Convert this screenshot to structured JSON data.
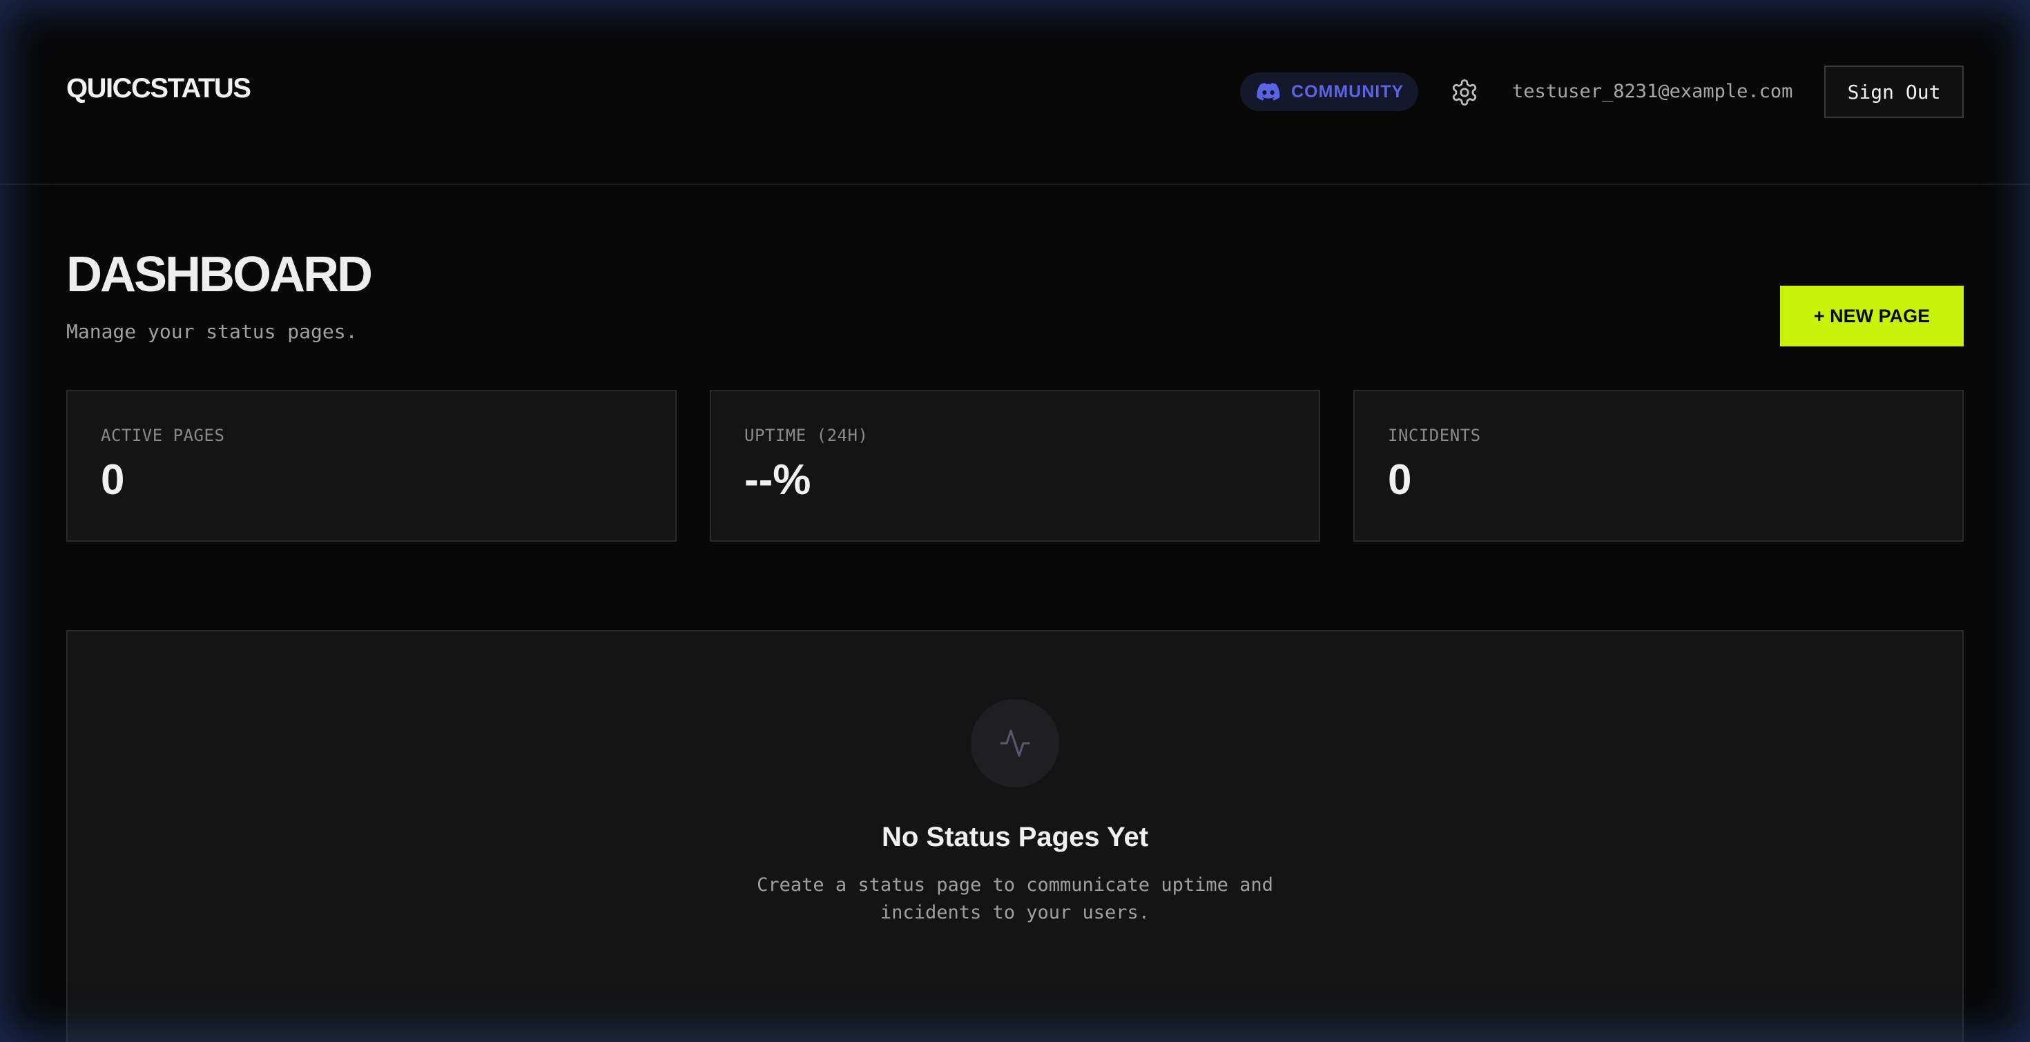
{
  "header": {
    "brand": "QUICCSTATUS",
    "community_label": "COMMUNITY",
    "user_email": "testuser_8231@example.com",
    "sign_out_label": "Sign Out"
  },
  "dashboard": {
    "title": "DASHBOARD",
    "subtitle": "Manage your status pages.",
    "new_page_label": "+ NEW PAGE"
  },
  "stats": [
    {
      "label": "ACTIVE PAGES",
      "value": "0"
    },
    {
      "label": "UPTIME (24H)",
      "value": "--%"
    },
    {
      "label": "INCIDENTS",
      "value": "0"
    }
  ],
  "empty_state": {
    "title": "No Status Pages Yet",
    "text": "Create a status page to communicate uptime and incidents to your users."
  },
  "icons": {
    "community": "discord-icon",
    "settings": "gear-icon",
    "empty": "activity-icon"
  },
  "colors": {
    "accent": "#c8f20a",
    "discord": "#5b63e6",
    "background": "#080808",
    "card": "#141414"
  }
}
